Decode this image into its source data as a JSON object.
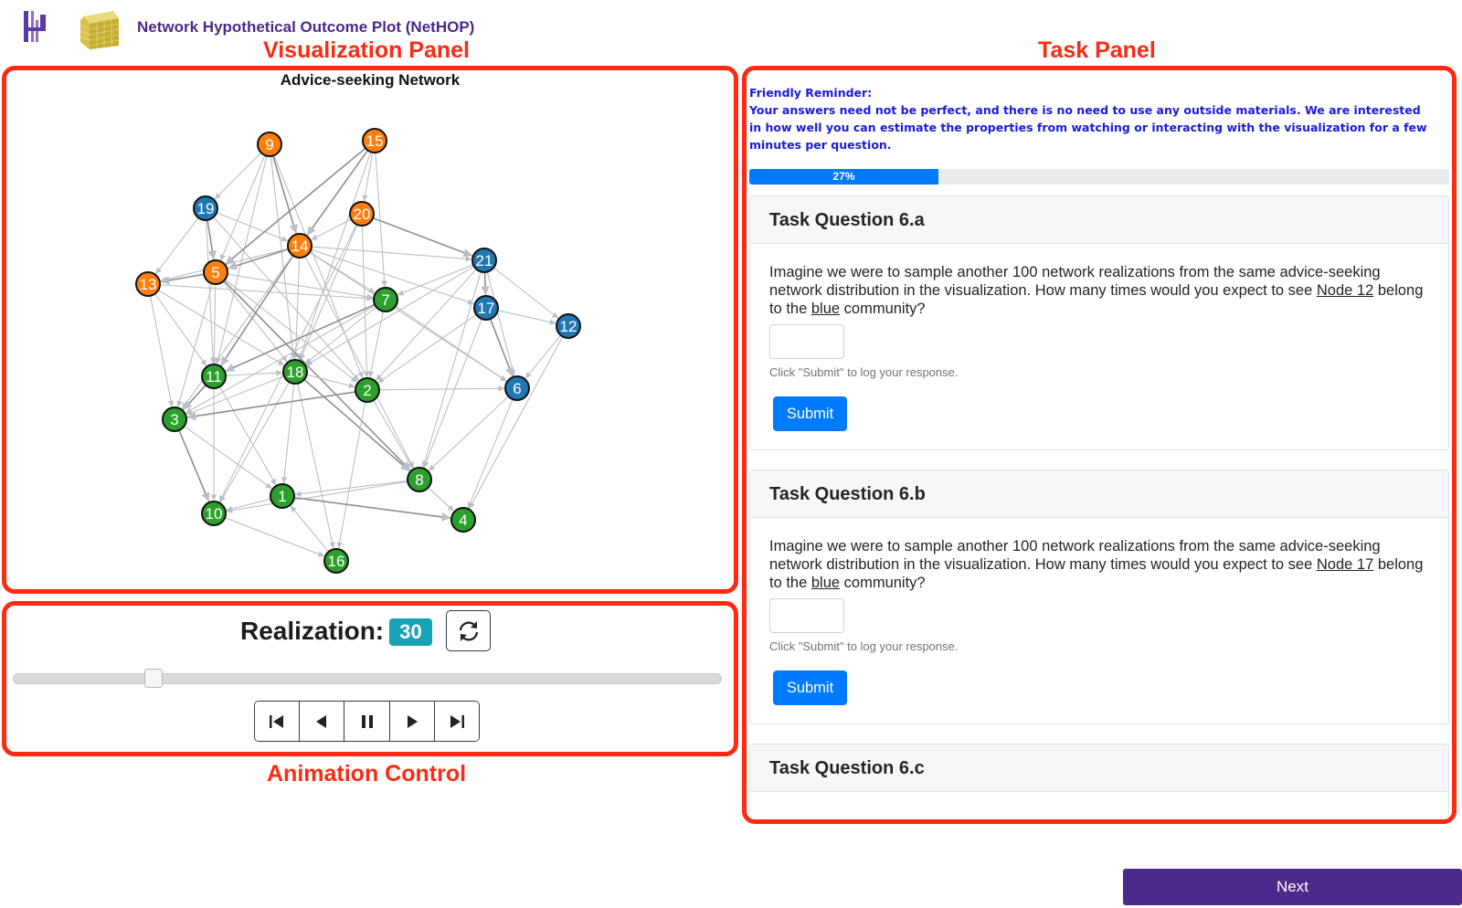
{
  "header": {
    "title": "Network Hypothetical Outcome Plot (NetHOP)",
    "logo_name": "hop-logo",
    "cube_logo_name": "cube-logo"
  },
  "callouts": {
    "visualization": "Visualization Panel",
    "task": "Task Panel",
    "animation": "Animation Control"
  },
  "graph": {
    "title": "Advice-seeking Network",
    "colors": {
      "orange": "#ff7f0e",
      "blue": "#1f77b4",
      "green": "#2ca02c",
      "edge": "#b9bfc6",
      "edge_dark": "#8a8f96"
    },
    "nodes": [
      {
        "id": "9",
        "group": "orange"
      },
      {
        "id": "15",
        "group": "orange"
      },
      {
        "id": "20",
        "group": "orange"
      },
      {
        "id": "14",
        "group": "orange"
      },
      {
        "id": "5",
        "group": "orange"
      },
      {
        "id": "13",
        "group": "orange"
      },
      {
        "id": "19",
        "group": "blue"
      },
      {
        "id": "21",
        "group": "blue"
      },
      {
        "id": "17",
        "group": "blue"
      },
      {
        "id": "12",
        "group": "blue"
      },
      {
        "id": "6",
        "group": "blue"
      },
      {
        "id": "7",
        "group": "green"
      },
      {
        "id": "11",
        "group": "green"
      },
      {
        "id": "18",
        "group": "green"
      },
      {
        "id": "2",
        "group": "green"
      },
      {
        "id": "3",
        "group": "green"
      },
      {
        "id": "8",
        "group": "green"
      },
      {
        "id": "1",
        "group": "green"
      },
      {
        "id": "10",
        "group": "green"
      },
      {
        "id": "4",
        "group": "green"
      },
      {
        "id": "16",
        "group": "green"
      }
    ],
    "edges": [
      [
        "9",
        "14"
      ],
      [
        "9",
        "5"
      ],
      [
        "9",
        "18"
      ],
      [
        "9",
        "11"
      ],
      [
        "9",
        "2"
      ],
      [
        "15",
        "14"
      ],
      [
        "15",
        "20"
      ],
      [
        "15",
        "7"
      ],
      [
        "15",
        "18"
      ],
      [
        "19",
        "14"
      ],
      [
        "19",
        "5"
      ],
      [
        "19",
        "2"
      ],
      [
        "19",
        "11"
      ],
      [
        "20",
        "14"
      ],
      [
        "20",
        "2"
      ],
      [
        "20",
        "21"
      ],
      [
        "20",
        "18"
      ],
      [
        "14",
        "21"
      ],
      [
        "14",
        "7"
      ],
      [
        "14",
        "17"
      ],
      [
        "14",
        "5"
      ],
      [
        "14",
        "13"
      ],
      [
        "14",
        "18"
      ],
      [
        "14",
        "8"
      ],
      [
        "14",
        "6"
      ],
      [
        "5",
        "13"
      ],
      [
        "5",
        "7"
      ],
      [
        "5",
        "11"
      ],
      [
        "5",
        "18"
      ],
      [
        "5",
        "2"
      ],
      [
        "5",
        "8"
      ],
      [
        "13",
        "7"
      ],
      [
        "13",
        "11"
      ],
      [
        "13",
        "18"
      ],
      [
        "21",
        "7"
      ],
      [
        "21",
        "17"
      ],
      [
        "21",
        "6"
      ],
      [
        "21",
        "18"
      ],
      [
        "21",
        "2"
      ],
      [
        "21",
        "12"
      ],
      [
        "17",
        "6"
      ],
      [
        "17",
        "8"
      ],
      [
        "17",
        "2"
      ],
      [
        "12",
        "6"
      ],
      [
        "12",
        "4"
      ],
      [
        "7",
        "11"
      ],
      [
        "7",
        "2"
      ],
      [
        "7",
        "18"
      ],
      [
        "7",
        "3"
      ],
      [
        "7",
        "6"
      ],
      [
        "11",
        "3"
      ],
      [
        "11",
        "18"
      ],
      [
        "11",
        "1"
      ],
      [
        "11",
        "10"
      ],
      [
        "18",
        "2"
      ],
      [
        "18",
        "8"
      ],
      [
        "18",
        "3"
      ],
      [
        "18",
        "10"
      ],
      [
        "18",
        "1"
      ],
      [
        "18",
        "16"
      ],
      [
        "2",
        "3"
      ],
      [
        "2",
        "8"
      ],
      [
        "2",
        "16"
      ],
      [
        "2",
        "6"
      ],
      [
        "3",
        "1"
      ],
      [
        "3",
        "10"
      ],
      [
        "8",
        "4"
      ],
      [
        "8",
        "1"
      ],
      [
        "8",
        "10"
      ],
      [
        "1",
        "10"
      ],
      [
        "1",
        "4"
      ],
      [
        "10",
        "16"
      ],
      [
        "16",
        "1"
      ],
      [
        "6",
        "8"
      ],
      [
        "6",
        "4"
      ],
      [
        "14",
        "11"
      ],
      [
        "5",
        "3"
      ],
      [
        "9",
        "19"
      ],
      [
        "13",
        "3"
      ],
      [
        "14",
        "3"
      ],
      [
        "15",
        "5"
      ],
      [
        "20",
        "10"
      ],
      [
        "19",
        "13"
      ],
      [
        "21",
        "8"
      ],
      [
        "17",
        "12"
      ]
    ]
  },
  "animation": {
    "label": "Realization:",
    "value": "30",
    "slider_fraction": 0.19
  },
  "task": {
    "reminder_title": "Friendly Reminder:",
    "reminder_text": "Your answers need not be perfect, and there is no need to use any outside materials. We are interested in how well you can estimate the properties from watching or interacting with the visualization for a few minutes per question.",
    "progress_label": "27%",
    "progress_fraction": 0.27,
    "questions": [
      {
        "title": "Task Question 6.a",
        "text_before": "Imagine we were to sample another 100 network realizations from the same advice-seeking network distribution in the visualization. How many times would you expect to see ",
        "node": "Node 12",
        "text_middle": " belong to the ",
        "community": "blue",
        "text_after": " community?",
        "input_value": "",
        "hint": "Click \"Submit\" to log your response.",
        "submit_label": "Submit"
      },
      {
        "title": "Task Question 6.b",
        "text_before": "Imagine we were to sample another 100 network realizations from the same advice-seeking network distribution in the visualization. How many times would you expect to see ",
        "node": "Node 17",
        "text_middle": " belong to the ",
        "community": "blue",
        "text_after": " community?",
        "input_value": "",
        "hint": "Click \"Submit\" to log your response.",
        "submit_label": "Submit"
      },
      {
        "title": "Task Question 6.c"
      }
    ]
  },
  "footer": {
    "next_label": "Next"
  }
}
